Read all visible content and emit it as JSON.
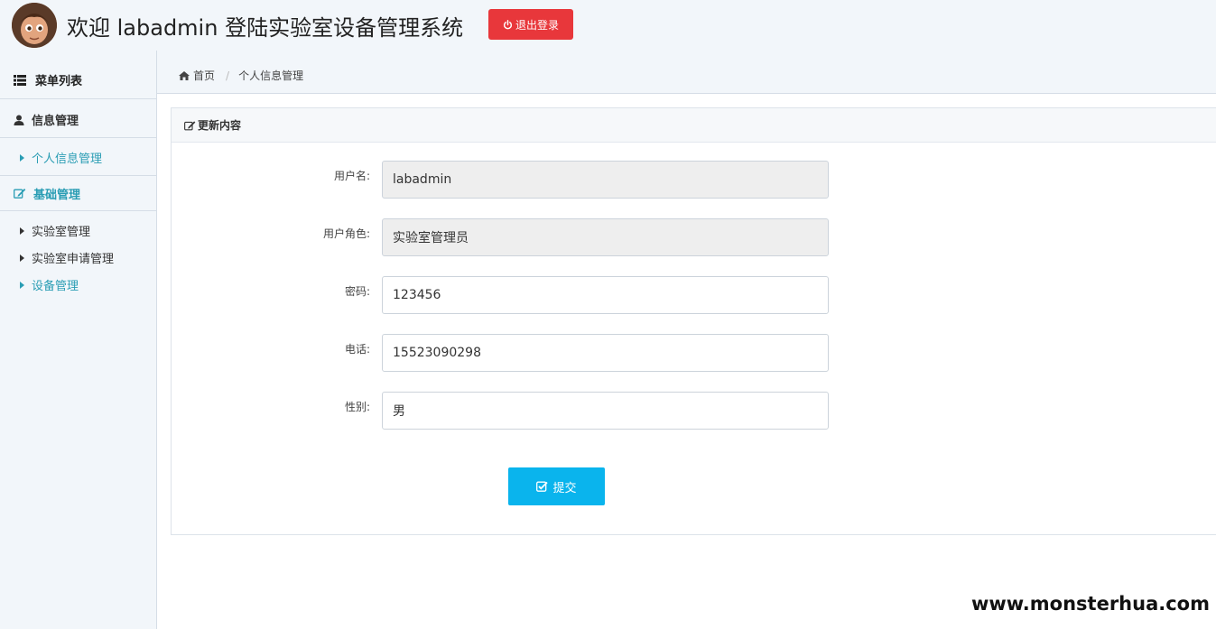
{
  "header": {
    "title": "欢迎 labadmin 登陆实验室设备管理系统",
    "logout_label": "退出登录"
  },
  "sidebar": {
    "heading": "菜单列表",
    "groups": [
      {
        "label": "信息管理",
        "items": [
          {
            "label": "个人信息管理",
            "active": true
          }
        ]
      },
      {
        "label": "基础管理",
        "items": [
          {
            "label": "实验室管理"
          },
          {
            "label": "实验室申请管理"
          },
          {
            "label": "设备管理",
            "active": true
          }
        ]
      }
    ]
  },
  "breadcrumb": {
    "home": "首页",
    "current": "个人信息管理"
  },
  "panel": {
    "title": "更新内容",
    "fields": [
      {
        "label": "用户名:",
        "value": "labadmin",
        "readonly": true
      },
      {
        "label": "用户角色:",
        "value": "实验室管理员",
        "readonly": true
      },
      {
        "label": "密码:",
        "value": "123456",
        "readonly": false
      },
      {
        "label": "电话:",
        "value": "15523090298",
        "readonly": false
      },
      {
        "label": "性别:",
        "value": "男",
        "readonly": false
      }
    ],
    "submit_label": "提交"
  },
  "watermark": "www.monsterhua.com",
  "colors": {
    "logout": "#e8373b",
    "submit": "#0ab4ed",
    "accent": "#2a9db4"
  }
}
